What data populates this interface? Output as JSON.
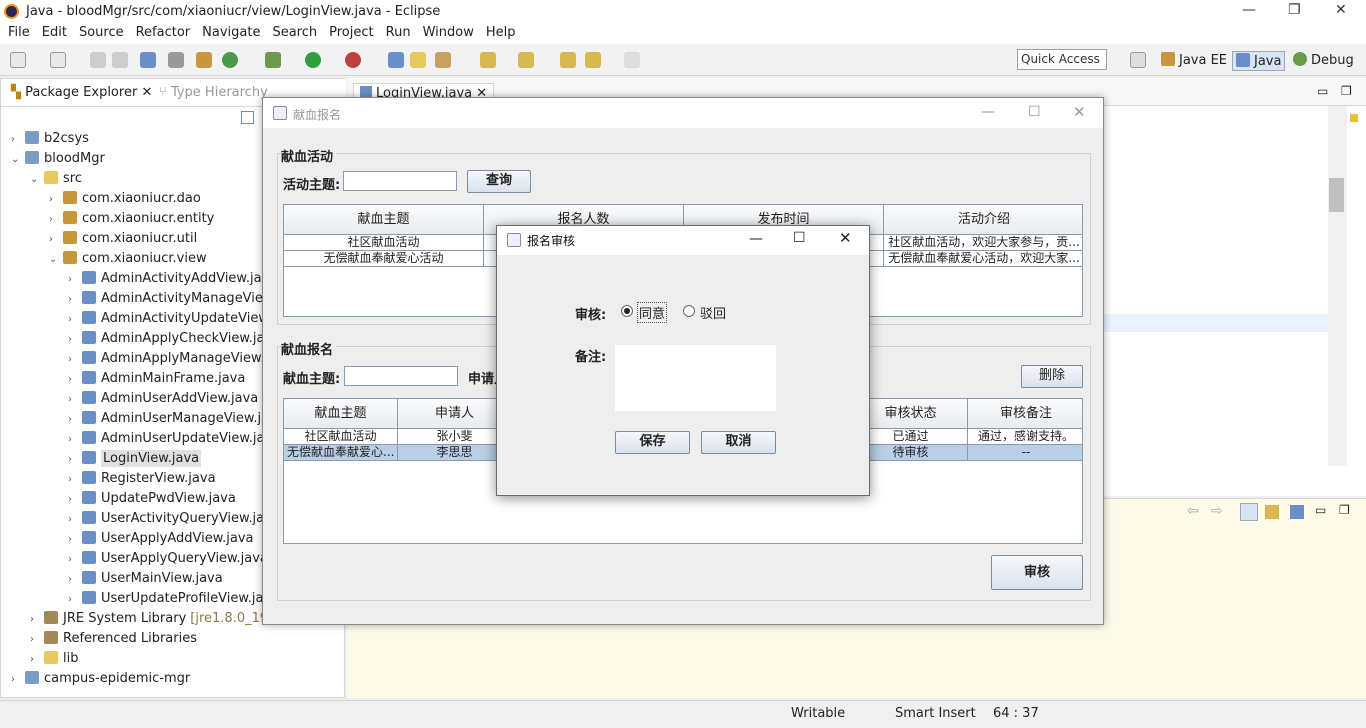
{
  "window": {
    "title": "Java - bloodMgr/src/com/xiaoniucr/view/LoginView.java - Eclipse",
    "min": "—",
    "restore": "❐",
    "close": "✕"
  },
  "menu": [
    "File",
    "Edit",
    "Source",
    "Refactor",
    "Navigate",
    "Search",
    "Project",
    "Run",
    "Window",
    "Help"
  ],
  "toolbar": {
    "quick_access": "Quick Access",
    "perspectives": [
      "Java EE",
      "Java",
      "Debug"
    ]
  },
  "explorer": {
    "tabs": [
      "Package Explorer",
      "Type Hierarchy"
    ],
    "tree": [
      {
        "label": "b2csys",
        "depth": 0,
        "arrow": "›",
        "icon": "project-icon"
      },
      {
        "label": "bloodMgr",
        "depth": 0,
        "arrow": "⌄",
        "icon": "project-icon"
      },
      {
        "label": "src",
        "depth": 1,
        "arrow": "⌄",
        "icon": "source-folder-icon"
      },
      {
        "label": "com.xiaoniucr.dao",
        "depth": 2,
        "arrow": "›",
        "icon": "package-icon"
      },
      {
        "label": "com.xiaoniucr.entity",
        "depth": 2,
        "arrow": "›",
        "icon": "package-icon"
      },
      {
        "label": "com.xiaoniucr.util",
        "depth": 2,
        "arrow": "›",
        "icon": "package-icon"
      },
      {
        "label": "com.xiaoniucr.view",
        "depth": 2,
        "arrow": "⌄",
        "icon": "package-icon"
      },
      {
        "label": "AdminActivityAddView.java",
        "depth": 3,
        "arrow": "›",
        "icon": "java-file-icon"
      },
      {
        "label": "AdminActivityManageView.j",
        "depth": 3,
        "arrow": "›",
        "icon": "java-file-icon"
      },
      {
        "label": "AdminActivityUpdateView.ja",
        "depth": 3,
        "arrow": "›",
        "icon": "java-file-icon"
      },
      {
        "label": "AdminApplyCheckView.java",
        "depth": 3,
        "arrow": "›",
        "icon": "java-file-icon"
      },
      {
        "label": "AdminApplyManageView.ja",
        "depth": 3,
        "arrow": "›",
        "icon": "java-file-icon"
      },
      {
        "label": "AdminMainFrame.java",
        "depth": 3,
        "arrow": "›",
        "icon": "java-file-icon"
      },
      {
        "label": "AdminUserAddView.java",
        "depth": 3,
        "arrow": "›",
        "icon": "java-file-icon"
      },
      {
        "label": "AdminUserManageView.jav",
        "depth": 3,
        "arrow": "›",
        "icon": "java-file-icon"
      },
      {
        "label": "AdminUserUpdateView.java",
        "depth": 3,
        "arrow": "›",
        "icon": "java-file-icon"
      },
      {
        "label": "LoginView.java",
        "depth": 3,
        "arrow": "›",
        "icon": "java-file-icon",
        "selected": true
      },
      {
        "label": "RegisterView.java",
        "depth": 3,
        "arrow": "›",
        "icon": "java-file-icon"
      },
      {
        "label": "UpdatePwdView.java",
        "depth": 3,
        "arrow": "›",
        "icon": "java-file-icon"
      },
      {
        "label": "UserActivityQueryView.java",
        "depth": 3,
        "arrow": "›",
        "icon": "java-file-icon"
      },
      {
        "label": "UserApplyAddView.java",
        "depth": 3,
        "arrow": "›",
        "icon": "java-file-icon"
      },
      {
        "label": "UserApplyQueryView.java",
        "depth": 3,
        "arrow": "›",
        "icon": "java-file-icon"
      },
      {
        "label": "UserMainView.java",
        "depth": 3,
        "arrow": "›",
        "icon": "java-file-icon"
      },
      {
        "label": "UserUpdateProfileView.java",
        "depth": 3,
        "arrow": "›",
        "icon": "java-file-icon"
      },
      {
        "label": "JRE System Library",
        "suffix": "[jre1.8.0_191]",
        "depth": 1,
        "arrow": "›",
        "icon": "library-icon"
      },
      {
        "label": "Referenced Libraries",
        "depth": 1,
        "arrow": "›",
        "icon": "library-icon"
      },
      {
        "label": "lib",
        "depth": 1,
        "arrow": "›",
        "icon": "folder-icon"
      },
      {
        "label": "campus-epidemic-mgr",
        "depth": 0,
        "arrow": "›",
        "icon": "project-icon"
      }
    ]
  },
  "editor": {
    "tab": "LoginView.java"
  },
  "status": {
    "writable": "Writable",
    "insert": "Smart Insert",
    "position": "64 : 37"
  },
  "swing": {
    "title": "献血报名",
    "activity_section": {
      "legend": "献血活动",
      "topic_label": "活动主题:",
      "query_button": "查询",
      "columns": [
        "献血主题",
        "报名人数",
        "发布时间",
        "活动介绍"
      ],
      "rows": [
        [
          "社区献血活动",
          "",
          "",
          "社区献血活动，欢迎大家参与，贡..."
        ],
        [
          "无偿献血奉献爱心活动",
          "",
          "",
          "无偿献血奉献爱心活动，欢迎大家..."
        ]
      ]
    },
    "apply_section": {
      "legend": "献血报名",
      "topic_label": "献血主题:",
      "applicant_label": "申请人",
      "delete_button": "删除",
      "columns": [
        "献血主题",
        "申请人",
        "审核状态",
        "审核备注"
      ],
      "rows": [
        [
          "社区献血活动",
          "张小斐",
          "已通过",
          "通过，感谢支持。"
        ],
        [
          "无偿献血奉献爱心...",
          "李思思",
          "待审核",
          "--"
        ]
      ]
    },
    "audit_button": "审核"
  },
  "dialog": {
    "title": "报名审核",
    "audit_label": "审核:",
    "options": [
      "同意",
      "驳回"
    ],
    "selected": "同意",
    "remark_label": "备注:",
    "remark_value": "",
    "save_button": "保存",
    "cancel_button": "取消"
  }
}
